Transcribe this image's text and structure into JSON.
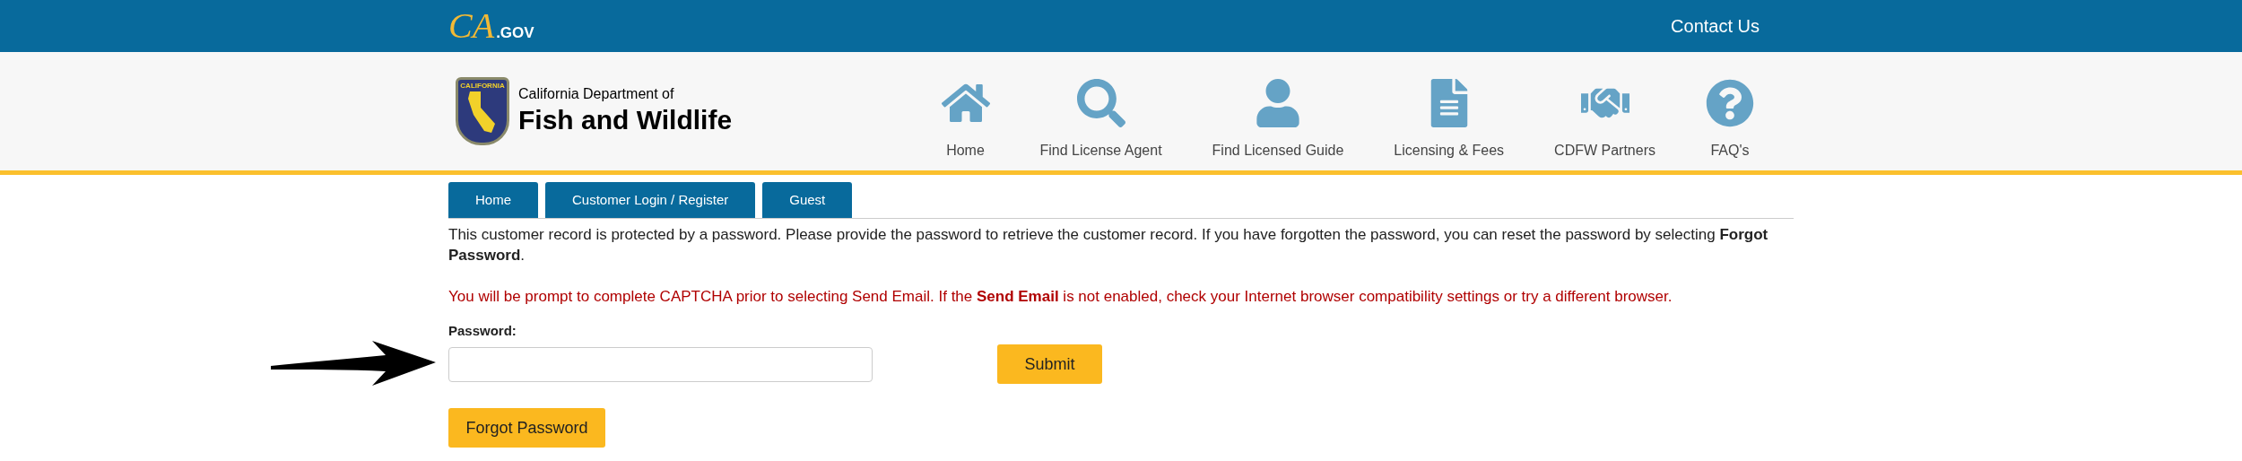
{
  "top_bar": {
    "logo": {
      "mark": "CA",
      "suffix": ".GOV"
    },
    "link": "Contact Us"
  },
  "header": {
    "seal_text": "CALIFORNIA",
    "department": "California Department of",
    "title": "Fish and Wildlife",
    "nav": [
      {
        "label": "Home"
      },
      {
        "label": "Find License Agent"
      },
      {
        "label": "Find Licensed Guide"
      },
      {
        "label": "Licensing & Fees"
      },
      {
        "label": "CDFW Partners"
      },
      {
        "label": "FAQ's"
      }
    ]
  },
  "tabs": [
    {
      "label": "Home"
    },
    {
      "label": "Customer Login / Register"
    },
    {
      "label": "Guest"
    }
  ],
  "intro": "This customer record is protected by a password. Please provide the password to retrieve the customer record. If you have forgotten the password, you can reset the password by selecting **Forgot Password**.",
  "warning": "You will be prompt to complete CAPTCHA prior to selecting Send Email. If the **Send Email** is not enabled, check your Internet browser compatibility settings or try a different browser.",
  "form": {
    "label": "Password:",
    "submit": "Submit",
    "forgot": "Forgot Password"
  }
}
